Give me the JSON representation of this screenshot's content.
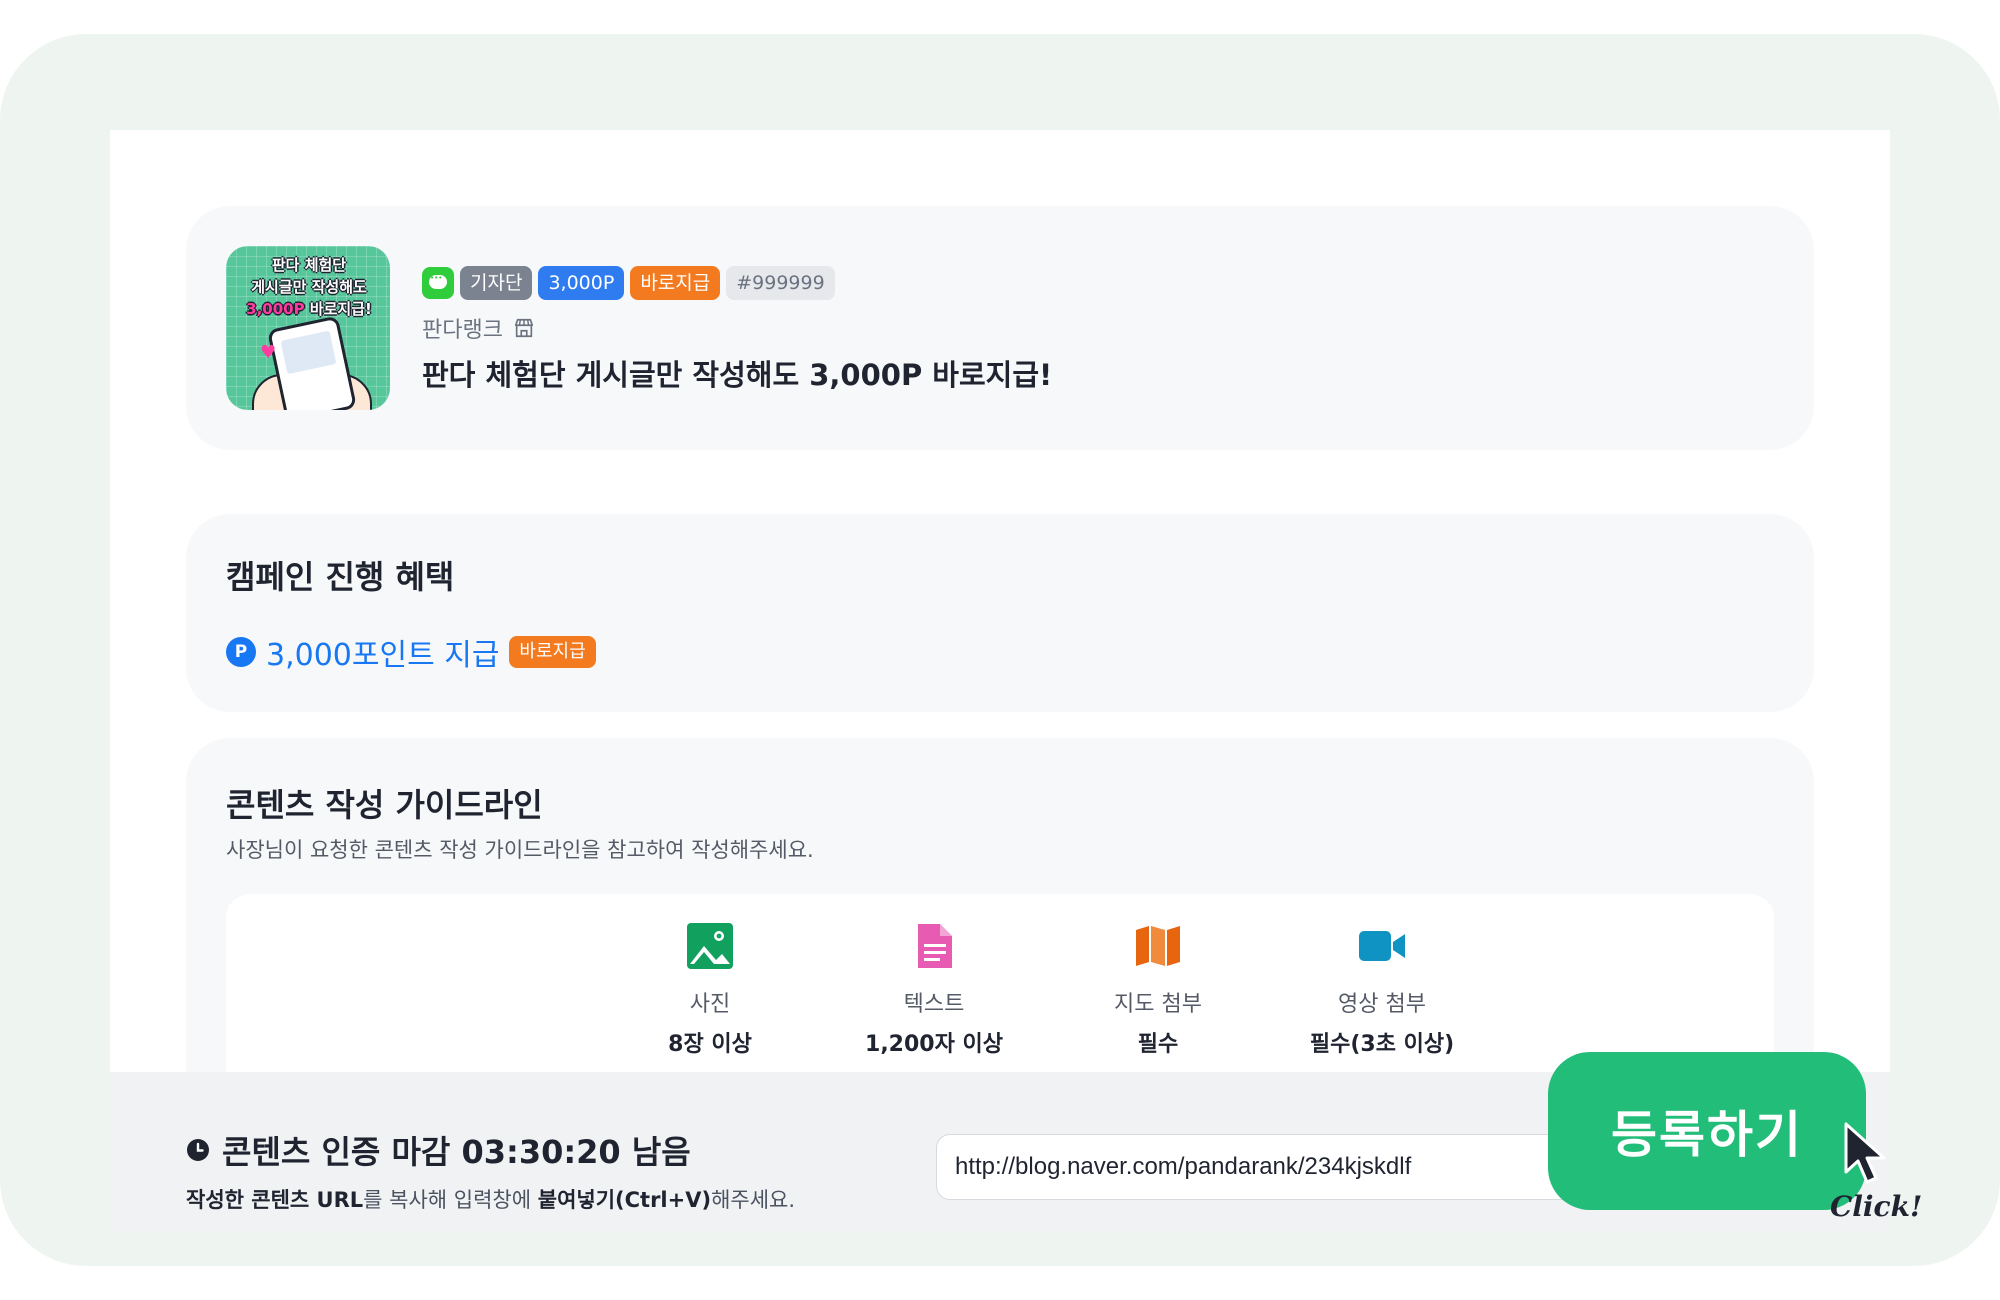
{
  "campaign": {
    "thumbnail": {
      "line1": "판다 체험단",
      "line2": "게시글만 작성해도",
      "line3_highlight": "3,000P",
      "line3_rest": " 바로지급!"
    },
    "badges": [
      "기자단",
      "3,000P",
      "바로지급",
      "#999999"
    ],
    "channel_icon": "chat-bubble-icon",
    "brand": "판다랭크",
    "brand_icon": "store-icon",
    "title": "판다 체험단 게시글만 작성해도 3,000P 바로지급!"
  },
  "benefits": {
    "title": "캠페인 진행 혜택",
    "icon": "point-icon",
    "icon_letter": "P",
    "text": "3,000포인트 지급",
    "badge": "바로지급"
  },
  "guidelines": {
    "title": "콘텐츠 작성 가이드라인",
    "subtitle": "사장님이 요청한 콘텐츠 작성 가이드라인을 참고하여 작성해주세요.",
    "items": [
      {
        "icon": "photo-icon",
        "label": "사진",
        "value": "8장 이상",
        "color": "#12a05f"
      },
      {
        "icon": "document-icon",
        "label": "텍스트",
        "value": "1,200자 이상",
        "color": "#e85bb3"
      },
      {
        "icon": "map-icon",
        "label": "지도 첨부",
        "value": "필수",
        "color": "#e8650f"
      },
      {
        "icon": "video-icon",
        "label": "영상 첨부",
        "value": "필수(3초 이상)",
        "color": "#0e93c2"
      }
    ]
  },
  "footer": {
    "deadline": "콘텐츠 인증 마감 03:30:20 남음",
    "instruction_a": "작성한 콘텐츠 URL",
    "instruction_b": "를 복사해 입력창에 ",
    "instruction_c": "붙여넣기(Ctrl+V)",
    "instruction_d": "해주세요.",
    "url_value": "http://blog.naver.com/pandarank/234kjskdlf",
    "register_label": "등록하기",
    "click_label": "Click!"
  },
  "colors": {
    "accent_green": "#23bd7a",
    "point_blue": "#1877f2",
    "badge_orange": "#f47a1f"
  }
}
